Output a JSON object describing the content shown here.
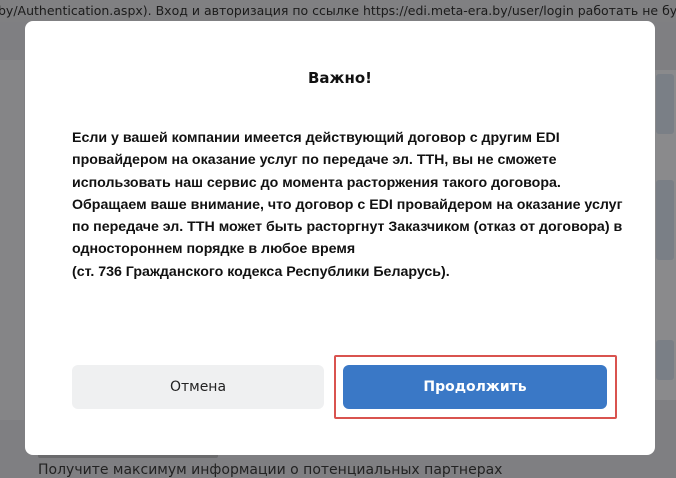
{
  "background": {
    "top_text": "by/Authentication.aspx). Вход и авторизация по ссылке https://edi.meta-era.by/user/login работать не бу",
    "bottom_text": "Получите максимум информации о потенциальных партнерах"
  },
  "modal": {
    "title": "Важно!",
    "paragraphs": [
      "Если у вашей компании имеется действующий договор с другим EDI провайдером на оказание услуг по передаче эл. ТТН, вы не сможете использовать наш сервис до момента расторжения такого договора.",
      "Обращаем ваше внимание, что договор с EDI провайдером на оказание услуг по передаче эл. ТТН может быть расторгнут Заказчиком (отказ от договора) в одностороннем порядке в любое время",
      "(ст. 736 Гражданского кодекса Республики Беларусь)."
    ],
    "buttons": {
      "cancel": "Отмена",
      "continue": "Продолжить"
    }
  },
  "colors": {
    "overlay": "#7f7f82",
    "primary_button": "#3a78c6",
    "secondary_button": "#eff0f1",
    "highlight_border": "#d9534f"
  }
}
